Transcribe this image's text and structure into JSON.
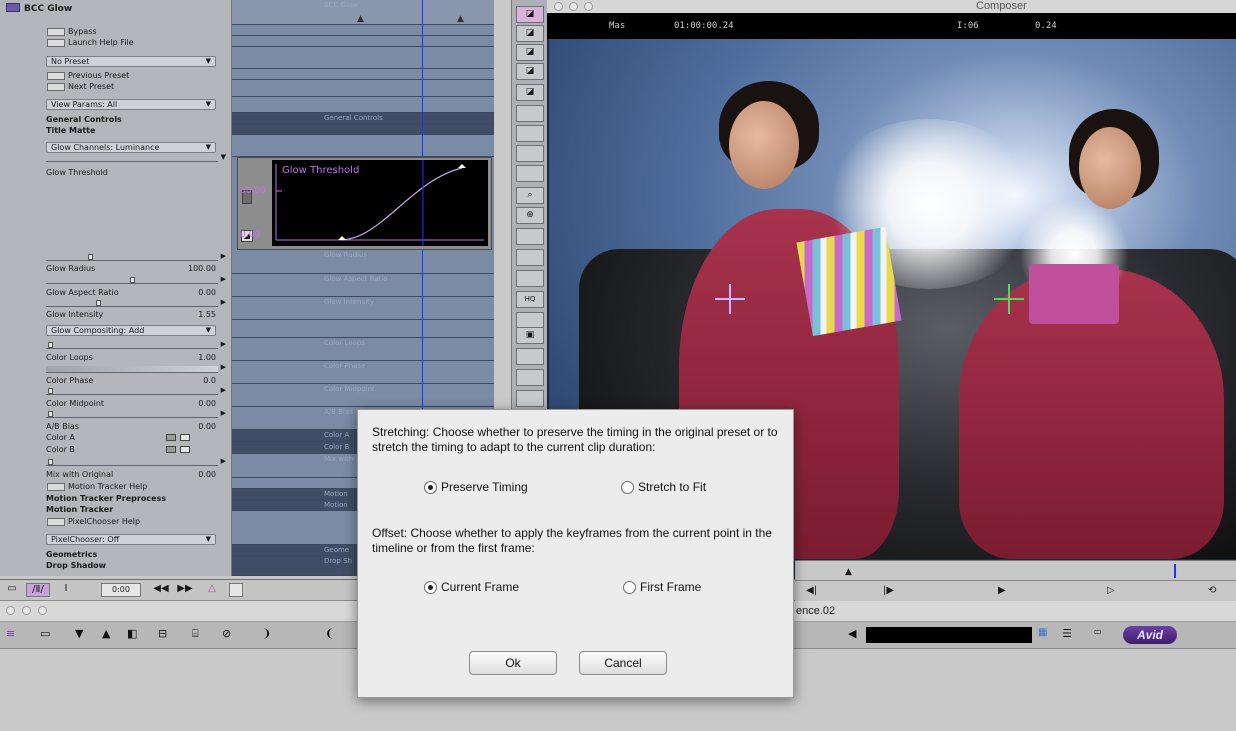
{
  "effect": {
    "title": "BCC Glow",
    "bypass": "Bypass",
    "launch_help": "Launch Help File",
    "preset_select": "No Preset",
    "previous_preset": "Previous Preset",
    "next_preset": "Next Preset",
    "view_params": "View Params: All",
    "general_controls": "General Controls",
    "title_matte": "Title Matte",
    "glow_channels": "Glow Channels: Luminance",
    "glow_threshold": "Glow Threshold",
    "glow_radius": {
      "label": "Glow Radius",
      "value": "100.00"
    },
    "glow_aspect": {
      "label": "Glow Aspect Ratio",
      "value": "0.00"
    },
    "glow_intensity": {
      "label": "Glow Intensity",
      "value": "1.55"
    },
    "glow_compositing": "Glow Compositing: Add",
    "color_loops": {
      "label": "Color Loops",
      "value": "1.00"
    },
    "color_phase": {
      "label": "Color Phase",
      "value": "0.0"
    },
    "color_midpoint": {
      "label": "Color Midpoint",
      "value": "0.00"
    },
    "ab_bias": {
      "label": "A/B Bias",
      "value": "0.00"
    },
    "color_a": "Color A",
    "color_b": "Color B",
    "mix_with_original": {
      "label": "Mix with Original",
      "value": "0.00"
    },
    "motion_tracker_help": "Motion Tracker Help",
    "motion_tracker_preprocess": "Motion Tracker Preprocess",
    "motion_tracker": "Motion Tracker",
    "pixelchooser_help": "PixelChooser Help",
    "pixelchooser_select": "PixelChooser: Off",
    "geometrics": "Geometrics",
    "drop_shadow": "Drop Shadow"
  },
  "tracks": {
    "top_label": "BCC Glow",
    "labels": [
      "General Controls",
      "Glow Radius",
      "Glow Aspect Ratio",
      "Glow Intensity",
      "Color Loops",
      "Color Phase",
      "Color Midpoint",
      "A/B Bias",
      "Color A",
      "Color B",
      "Mix with",
      "Motion",
      "Motion",
      "Geome",
      "Drop Sh"
    ]
  },
  "graph": {
    "title": "Glow Threshold",
    "y_high": "68.00",
    "y_low": "0.00"
  },
  "left_toolbar": {
    "time": "0:00"
  },
  "composer": {
    "title": "Composer",
    "left_info": "Mas",
    "timecode": "01:00:00.24",
    "right_info_1": "I:06",
    "right_info_2": "0.24"
  },
  "timeline": {
    "sequence_name": "ence.02",
    "logo": "Avid"
  },
  "dialog": {
    "stretching_text": "Stretching:  Choose whether to preserve the timing in the original preset or to stretch the timing to adapt to the current clip duration:",
    "preserve_timing": "Preserve Timing",
    "stretch_to_fit": "Stretch to Fit",
    "offset_text": "Offset:  Choose whether to apply the keyframes from the current point in the timeline or from the first frame:",
    "current_frame": "Current Frame",
    "first_frame": "First Frame",
    "ok": "Ok",
    "cancel": "Cancel",
    "stretching_selected": "Preserve Timing",
    "offset_selected": "Current Frame"
  },
  "colors": {
    "graph_accent": "#c66bf2",
    "playhead": "#2034ff",
    "track_blue": "#7a8ba6",
    "avid_purple": "#6d3fa8"
  }
}
